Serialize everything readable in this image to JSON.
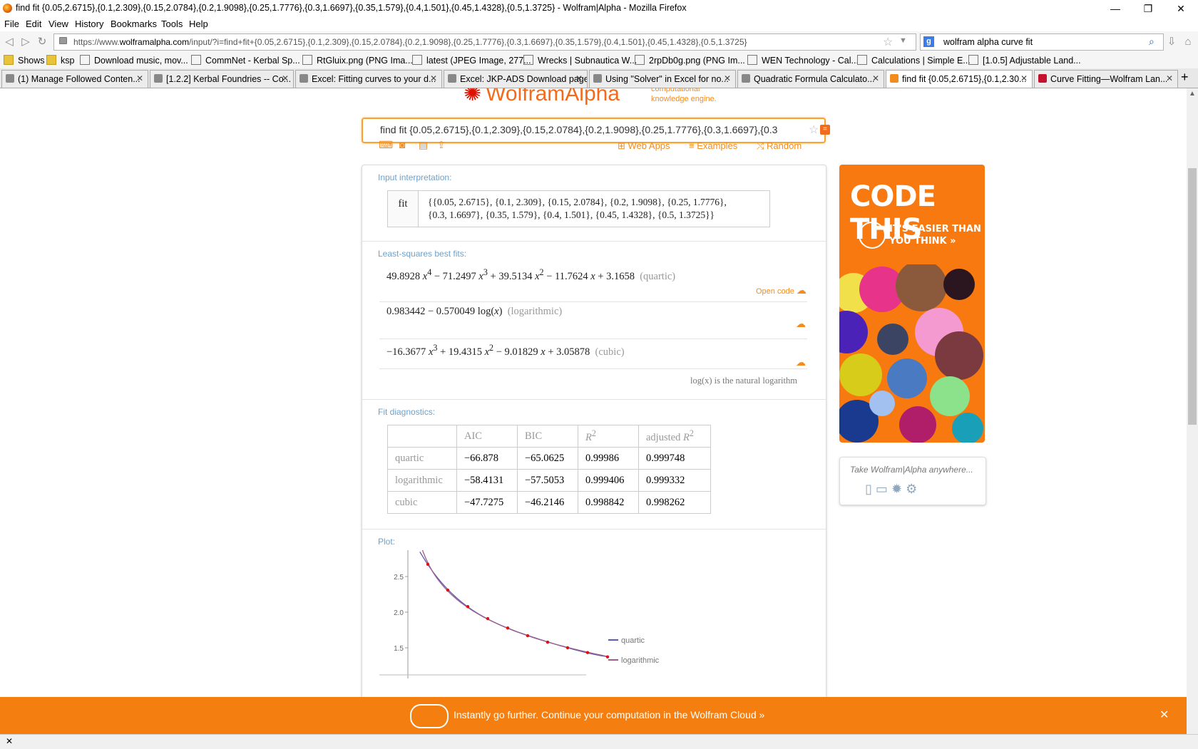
{
  "window": {
    "title": "find fit {0.05,2.6715},{0.1,2.309},{0.15,2.0784},{0.2,1.9098},{0.25,1.7776},{0.3,1.6697},{0.35,1.579},{0.4,1.501},{0.45,1.4328},{0.5,1.3725} - Wolfram|Alpha - Mozilla Firefox"
  },
  "menu": [
    "File",
    "Edit",
    "View",
    "History",
    "Bookmarks",
    "Tools",
    "Help"
  ],
  "address": {
    "prefix": "https://www.",
    "domain": "wolframalpha.com",
    "rest": "/input/?i=find+fit+{0.05,2.6715},{0.1,2.309},{0.15,2.0784},{0.2,1.9098},{0.25,1.7776},{0.3,1.6697},{0.35,1.579},{0.4,1.501},{0.45,1.4328},{0.5,1.3725}"
  },
  "search": {
    "value": "wolfram alpha curve fit"
  },
  "bookmarks": [
    "Shows",
    "ksp",
    "Download music, mov...",
    "CommNet - Kerbal Sp...",
    "RtGluix.png (PNG Ima...",
    "latest (JPEG Image, 277...",
    "Wrecks | Subnautica W...",
    "2rpDb0g.png (PNG Im...",
    "WEN Technology - Cal...",
    "Calculations | Simple E...",
    "[1.0.5] Adjustable Land..."
  ],
  "tabs": [
    "(1) Manage Followed Conten...",
    "[1.2.2] Kerbal Foundries -- Co...",
    "Excel: Fitting curves to your d...",
    "Excel: JKP-ADS Download page",
    "Using \"Solver\" in Excel for no...",
    "Quadratic Formula Calculato...",
    "find fit {0.05,2.6715},{0.1,2.30...",
    "Curve Fitting—Wolfram Lan..."
  ],
  "logo": {
    "text": "WolframAlpha",
    "tagline": "computational\nknowledge engine."
  },
  "query": "find fit {0.05,2.6715},{0.1,2.309},{0.15,2.0784},{0.2,1.9098},{0.25,1.7776},{0.3,1.6697},{0.3",
  "toolbar": {
    "webapps": "Web Apps",
    "examples": "Examples",
    "random": "Random"
  },
  "input_interp": {
    "header": "Input interpretation:",
    "fn": "fit",
    "line1": "{{0.05, 2.6715}, {0.1, 2.309}, {0.15, 2.0784}, {0.2, 1.9098}, {0.25, 1.7776},",
    "line2": "{0.3, 1.6697}, {0.35, 1.579}, {0.4, 1.501}, {0.45, 1.4328}, {0.5, 1.3725}}"
  },
  "fits": {
    "header": "Least-squares best fits:",
    "quartic_label": "(quartic)",
    "log_label": "(logarithmic)",
    "cubic_label": "(cubic)",
    "open_code": "Open code",
    "note": "log(x) is the natural logarithm"
  },
  "diagnostics": {
    "header": "Fit diagnostics:",
    "columns": [
      "",
      "AIC",
      "BIC",
      "R²",
      "adjusted R²"
    ],
    "rows": [
      [
        "quartic",
        "−66.878",
        "−65.0625",
        "0.99986",
        "0.999748"
      ],
      [
        "logarithmic",
        "−58.4131",
        "−57.5053",
        "0.999406",
        "0.999332"
      ],
      [
        "cubic",
        "−47.7275",
        "−46.2146",
        "0.998842",
        "0.998262"
      ]
    ]
  },
  "plot": {
    "header": "Plot:",
    "legend": [
      "quartic",
      "logarithmic"
    ],
    "colors": {
      "quartic": "#5b5bb5",
      "logarithmic": "#a05d8a",
      "points": "#dd1111"
    }
  },
  "chart_data": {
    "type": "scatter",
    "x": [
      0.05,
      0.1,
      0.15,
      0.2,
      0.25,
      0.3,
      0.35,
      0.4,
      0.45,
      0.5
    ],
    "y": [
      2.6715,
      2.309,
      2.0784,
      1.9098,
      1.7776,
      1.6697,
      1.579,
      1.501,
      1.4328,
      1.3725
    ],
    "yticks": [
      "1.5",
      "2.0",
      "2.5"
    ],
    "series": [
      {
        "name": "quartic"
      },
      {
        "name": "logarithmic"
      }
    ]
  },
  "ad": {
    "headline": "CODE THIS",
    "sub": "IT'S EASIER THAN YOU THINK »"
  },
  "anywhere": {
    "text": "Take Wolfram|Alpha anywhere..."
  },
  "banner": {
    "text": "Instantly go further. Continue your computation in the Wolfram Cloud »"
  }
}
